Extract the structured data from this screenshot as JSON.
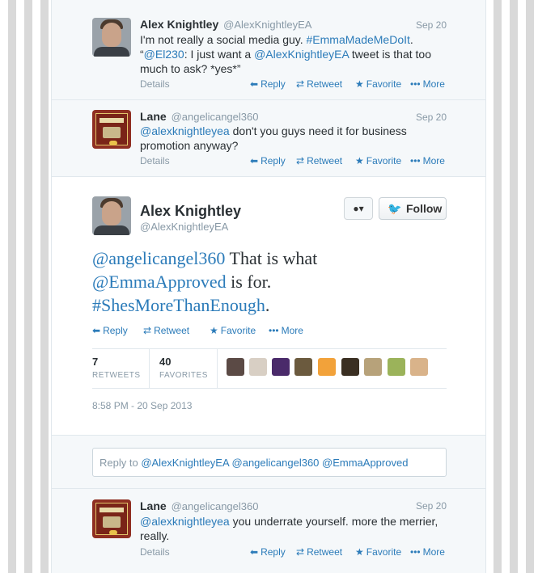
{
  "tweets": [
    {
      "name": "Alex Knightley",
      "handle": "@AlexKnightleyEA",
      "date": "Sep 20",
      "text_part1": "I'm not really a social media guy. ",
      "hashtag": "#EmmaMadeMeDoIt",
      "text_part2": ". “",
      "mention1": "@El230",
      "text_part3": ": I just want a ",
      "mention2": "@AlexKnightleyEA",
      "text_part4": " tweet is that too much to ask? *yes*”"
    },
    {
      "name": "Lane",
      "handle": "@angelicangel360",
      "date": "Sep 20",
      "mention": "@alexknightleyea",
      "text": " don't you guys need it for business promotion anyway?"
    },
    {
      "name": "Lane",
      "handle": "@angelicangel360",
      "date": "Sep 20",
      "mention": "@alexknightleyea",
      "text": " you underrate yourself. more the merrier, really."
    }
  ],
  "actions": {
    "details": "Details",
    "reply": "Reply",
    "retweet": "Retweet",
    "favorite": "Favorite",
    "more": "More"
  },
  "main_tweet": {
    "name": "Alex Knightley",
    "handle": "@AlexKnightleyEA",
    "follow_label": "Follow",
    "mention1": "@angelicangel360",
    "text1": " That is what",
    "mention2": "@EmmaApproved",
    "text2": " is for.",
    "hashtag": "#ShesMoreThanEnough",
    "text3": ".",
    "retweets_count": "7",
    "retweets_label": "RETWEETS",
    "favorites_count": "40",
    "favorites_label": "FAVORITES",
    "timestamp": "8:58 PM - 20 Sep 2013"
  },
  "reply_box": {
    "prefix": "Reply to ",
    "mentions": "@AlexKnightleyEA @angelicangel360 @EmmaApproved"
  },
  "icons": {
    "reply": "reply-arrow-icon",
    "retweet": "retweet-icon",
    "favorite": "star-icon",
    "more": "more-dots-icon",
    "follow": "twitter-bird-icon",
    "user_menu": "user-dropdown-icon"
  },
  "colors": {
    "link": "#2b7bb9",
    "muted": "#8899a6",
    "bird": "#55acee"
  }
}
